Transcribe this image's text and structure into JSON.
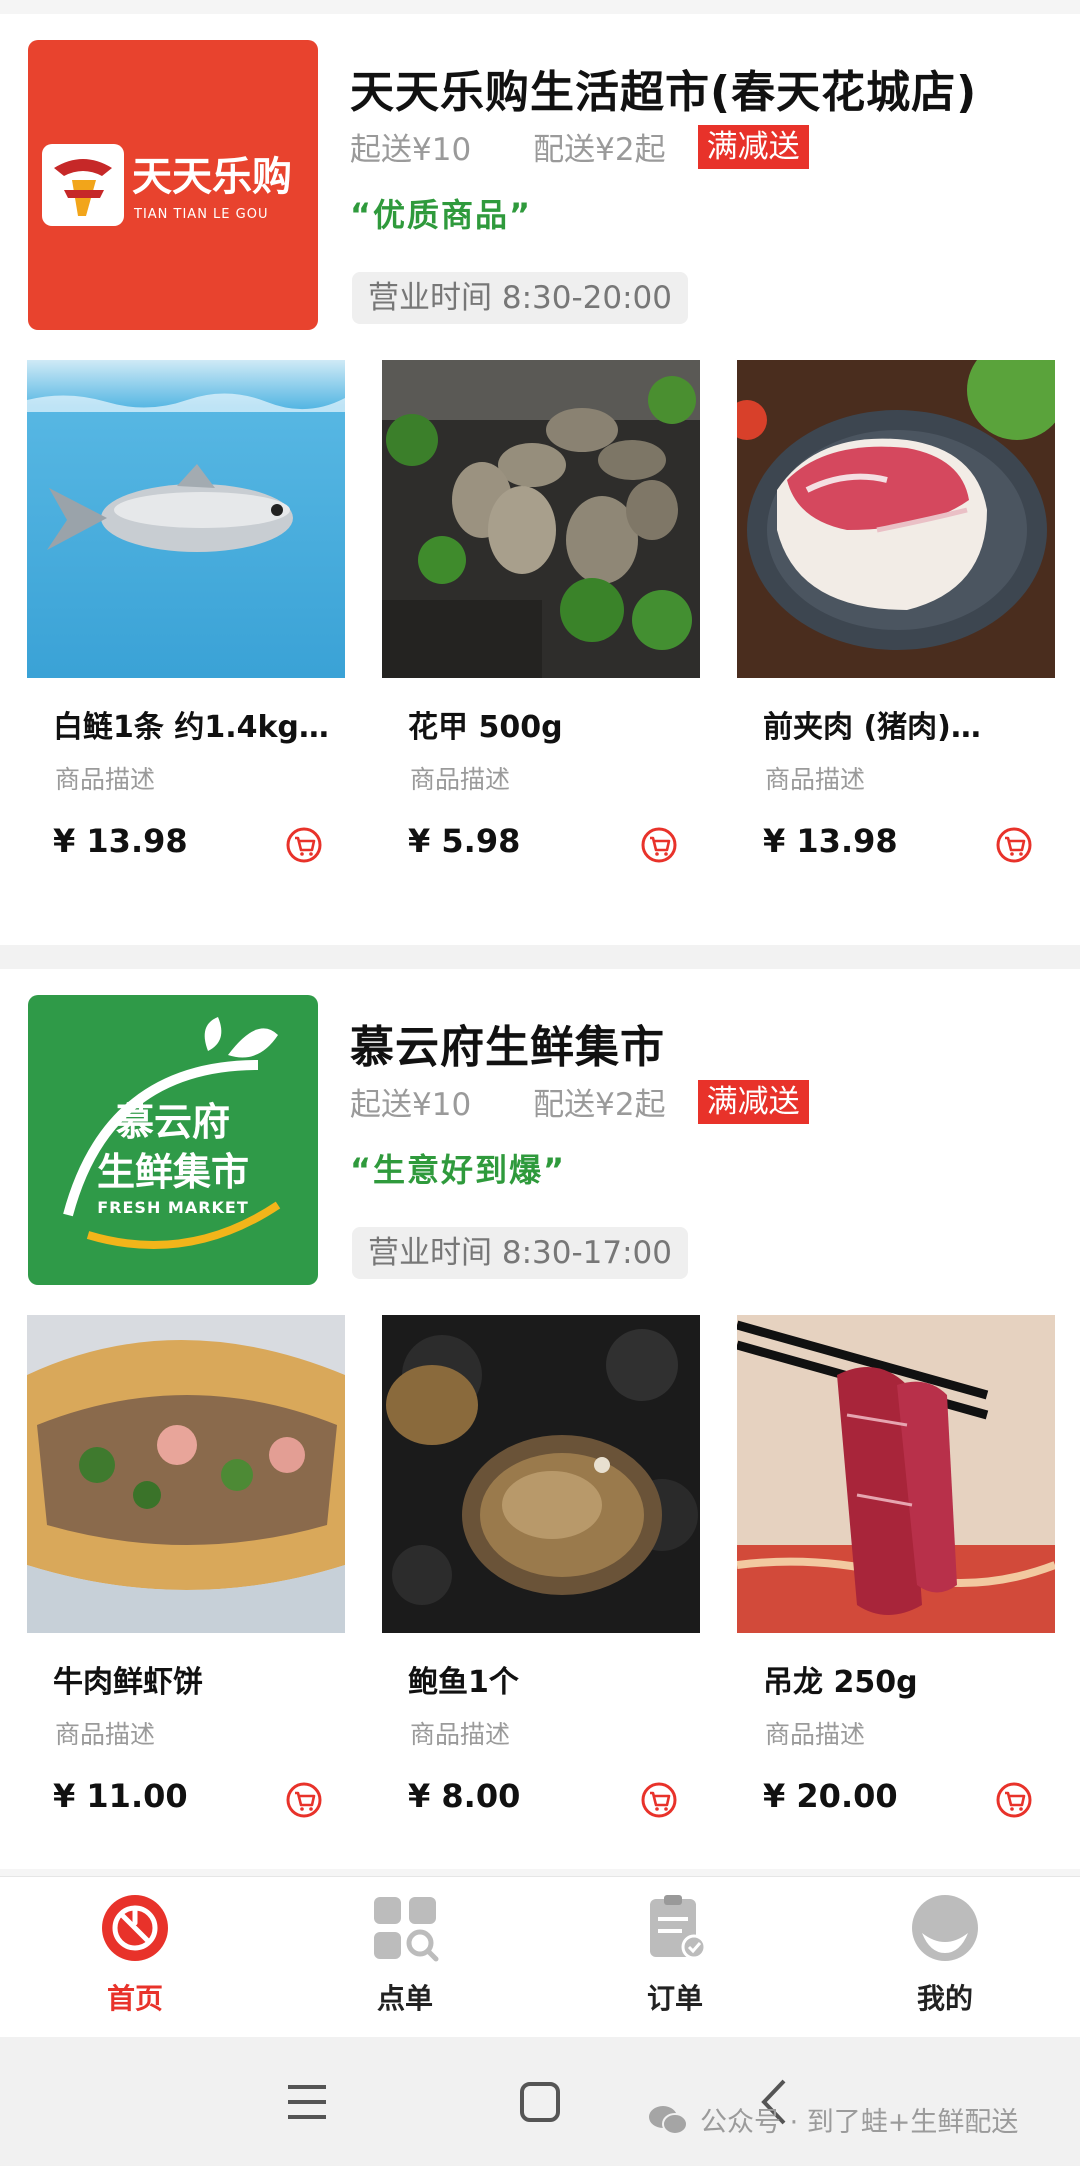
{
  "stores": [
    {
      "logo_text": "天天乐购",
      "logo_subtext": "TIAN TIAN LE GOU",
      "title": "天天乐购生活超市(春天花城店)",
      "min_order": "起送¥10",
      "delivery_fee": "配送¥2起",
      "badge": "满减送",
      "slogan": "“优质商品”",
      "hours": "营业时间 8:30-20:00",
      "products": [
        {
          "name": "白鲢1条 约1.4kg…",
          "desc": "商品描述",
          "price": "¥ 13.98"
        },
        {
          "name": "花甲 500g",
          "desc": "商品描述",
          "price": "¥ 5.98"
        },
        {
          "name": "前夹肉 (猪肉)…",
          "desc": "商品描述",
          "price": "¥ 13.98"
        }
      ]
    },
    {
      "logo_text_line1": "慕云府",
      "logo_text_line2": "生鲜集市",
      "logo_subtext": "FRESH MARKET",
      "title": "慕云府生鲜集市",
      "min_order": "起送¥10",
      "delivery_fee": "配送¥2起",
      "badge": "满减送",
      "slogan": "“生意好到爆”",
      "hours": "营业时间 8:30-17:00",
      "products": [
        {
          "name": "牛肉鲜虾饼",
          "desc": "商品描述",
          "price": "¥ 11.00"
        },
        {
          "name": "鲍鱼1个",
          "desc": "商品描述",
          "price": "¥ 8.00"
        },
        {
          "name": "吊龙 250g",
          "desc": "商品描述",
          "price": "¥ 20.00"
        }
      ]
    }
  ],
  "nav": [
    {
      "label": "首页",
      "icon": "home-icon",
      "active": true
    },
    {
      "label": "点单",
      "icon": "order-grid-icon",
      "active": false
    },
    {
      "label": "订单",
      "icon": "orders-list-icon",
      "active": false
    },
    {
      "label": "我的",
      "icon": "profile-icon",
      "active": false
    }
  ],
  "watermark": "公众号 · 到了蛙+生鲜配送",
  "colors": {
    "accent": "#e8322a",
    "green": "#2f9a3c",
    "logo1_bg": "#e8432e",
    "logo2_bg": "#2f9a48"
  }
}
